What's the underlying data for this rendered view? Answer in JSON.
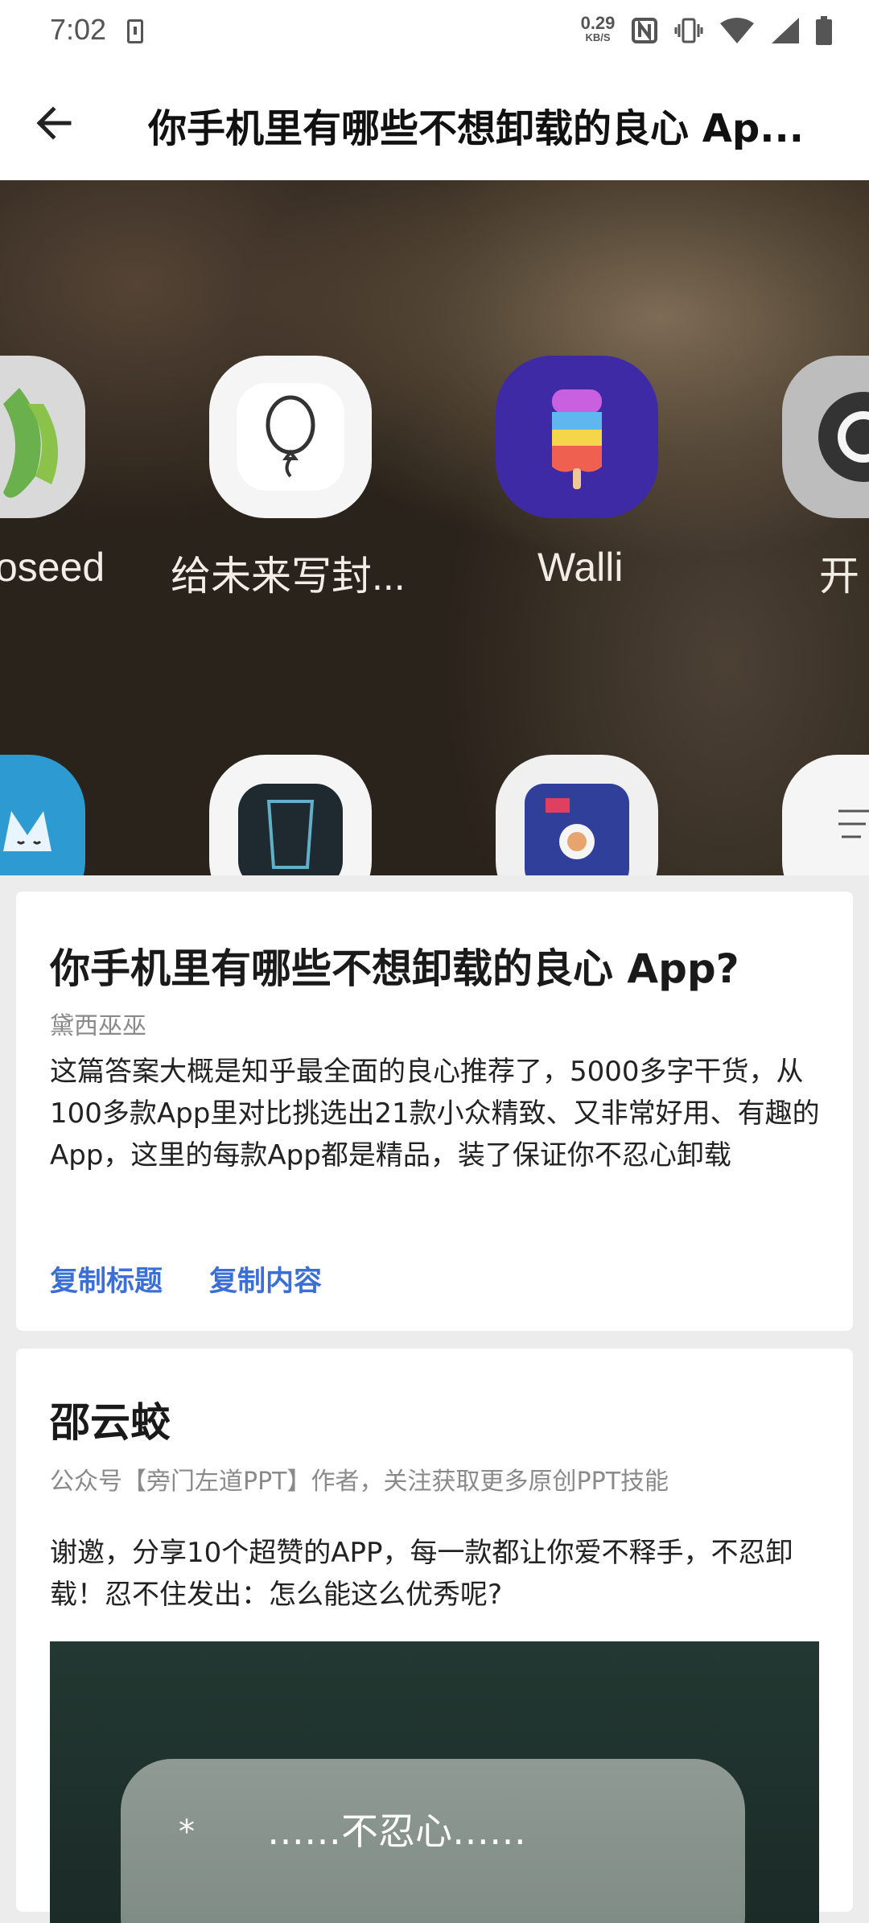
{
  "status_bar": {
    "time": "7:02",
    "net_speed_value": "0.29",
    "net_speed_unit": "KB/S",
    "icons": [
      "sim-icon",
      "nfc-icon",
      "vibrate-icon",
      "wifi-icon",
      "signal-icon",
      "battery-icon"
    ]
  },
  "app_bar": {
    "back_icon": "arrow-left-icon",
    "title": "你手机里有哪些不想卸载的良心 Ap..."
  },
  "hero": {
    "row1_labels": [
      "oseed",
      "给未来写封...",
      "Walli",
      "开"
    ],
    "row1_icons": [
      "snapseed-icon",
      "balloon-icon",
      "popsicle-icon",
      "camera-lens-icon"
    ],
    "row2_icons": [
      "cat-icon",
      "beaker-icon",
      "astronaut-icon",
      "document-icon"
    ]
  },
  "question_card": {
    "title": "你手机里有哪些不想卸载的良心 App?",
    "author": "黛西巫巫",
    "text": "这篇答案大概是知乎最全面的良心推荐了，5000多字干货，从100多款App里对比挑选出21款小众精致、又非常好用、有趣的App，这里的每款App都是精品，装了保证你不忍心卸载",
    "copy_title": "复制标题",
    "copy_content": "复制内容"
  },
  "answer_card": {
    "author_name": "邵云蛟",
    "author_bio": "公众号【旁门左道PPT】作者，关注获取更多原创PPT技能",
    "text": "谢邀，分享10个超赞的APP，每一款都让你爱不释手，不忍卸载！忍不住发出：怎么能这么优秀呢?",
    "image_star": "*",
    "image_text": "……不忍心……"
  },
  "colors": {
    "accent": "#3b6fd8",
    "background": "#ececec",
    "card": "#ffffff"
  }
}
